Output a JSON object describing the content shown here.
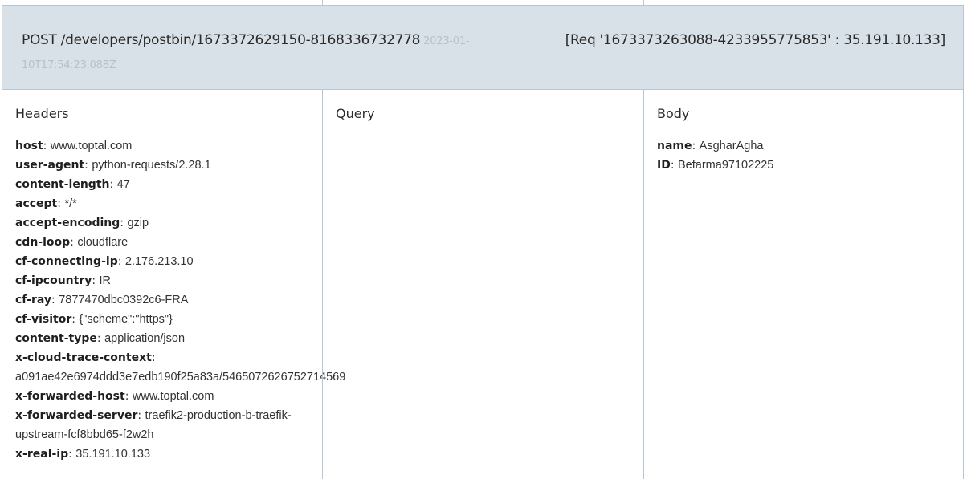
{
  "request": {
    "line": "POST /developers/postbin/1673372629150-8168336732778",
    "timestamp": "2023-01-10T17:54:23.088Z",
    "id_text": "[Req '1673373263088-4233955775853' : 35.191.10.133]"
  },
  "headers": {
    "title": "Headers",
    "items": [
      {
        "key": "host",
        "value": "www.toptal.com"
      },
      {
        "key": "user-agent",
        "value": "python-requests/2.28.1"
      },
      {
        "key": "content-length",
        "value": "47"
      },
      {
        "key": "accept",
        "value": "*/*"
      },
      {
        "key": "accept-encoding",
        "value": "gzip"
      },
      {
        "key": "cdn-loop",
        "value": "cloudflare"
      },
      {
        "key": "cf-connecting-ip",
        "value": "2.176.213.10"
      },
      {
        "key": "cf-ipcountry",
        "value": "IR"
      },
      {
        "key": "cf-ray",
        "value": "7877470dbc0392c6-FRA"
      },
      {
        "key": "cf-visitor",
        "value": "{\"scheme\":\"https\"}"
      },
      {
        "key": "content-type",
        "value": "application/json"
      },
      {
        "key": "x-cloud-trace-context",
        "value": "a091ae42e6974ddd3e7edb190f25a83a/5465072626752714569"
      },
      {
        "key": "x-forwarded-host",
        "value": "www.toptal.com"
      },
      {
        "key": "x-forwarded-server",
        "value": "traefik2-production-b-traefik-upstream-fcf8bbd65-f2w2h"
      },
      {
        "key": "x-real-ip",
        "value": "35.191.10.133"
      }
    ]
  },
  "query": {
    "title": "Query",
    "items": []
  },
  "body": {
    "title": "Body",
    "items": [
      {
        "key": "name",
        "value": "AsgharAgha"
      },
      {
        "key": "ID",
        "value": "Befarma97102225"
      }
    ]
  }
}
